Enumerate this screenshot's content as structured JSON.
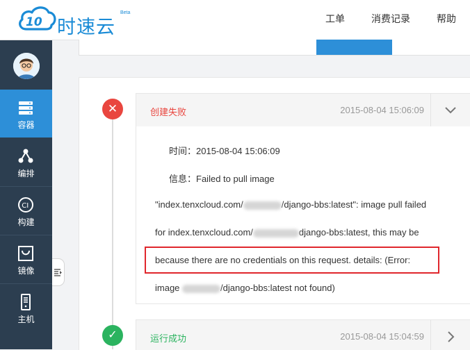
{
  "brand": {
    "logo_text": "时速云",
    "beta": "Beta",
    "primary_color": "#1a8bd6"
  },
  "header": {
    "nav": [
      {
        "label": "工单"
      },
      {
        "label": "消费记录"
      },
      {
        "label": "帮助"
      }
    ]
  },
  "sidebar": {
    "bg_color": "#2c3e50",
    "active_color": "#2d8fd8",
    "items": [
      {
        "label": "容器",
        "icon": "container-icon",
        "active": true
      },
      {
        "label": "编排",
        "icon": "orchestration-icon",
        "active": false
      },
      {
        "label": "构建",
        "icon": "ci-build-icon",
        "active": false
      },
      {
        "label": "镜像",
        "icon": "image-bag-icon",
        "active": false
      },
      {
        "label": "主机",
        "icon": "host-server-icon",
        "active": false
      }
    ]
  },
  "events": [
    {
      "status": "fail",
      "status_color": "#e9463f",
      "title": "创建失败",
      "time": "2015-08-04 15:06:09",
      "expanded": true,
      "details": {
        "time_label": "时间：",
        "time_value": "2015-08-04 15:06:09",
        "info_label": "信息：",
        "info_value": "Failed to pull image",
        "line3_prefix": "\"index.tenxcloud.com/",
        "line3_suffix": "/django-bbs:latest\": image pull failed",
        "line4_prefix": "for index.tenxcloud.com/",
        "line4_suffix": "django-bbs:latest, this may be",
        "line5": "because there are no credentials on this request. details: (Error:",
        "line6_prefix": "image",
        "line6_suffix": "/django-bbs:latest not found)"
      }
    },
    {
      "status": "ok",
      "status_color": "#2bb35f",
      "title": "运行成功",
      "time": "2015-08-04 15:04:59",
      "expanded": false
    }
  ]
}
